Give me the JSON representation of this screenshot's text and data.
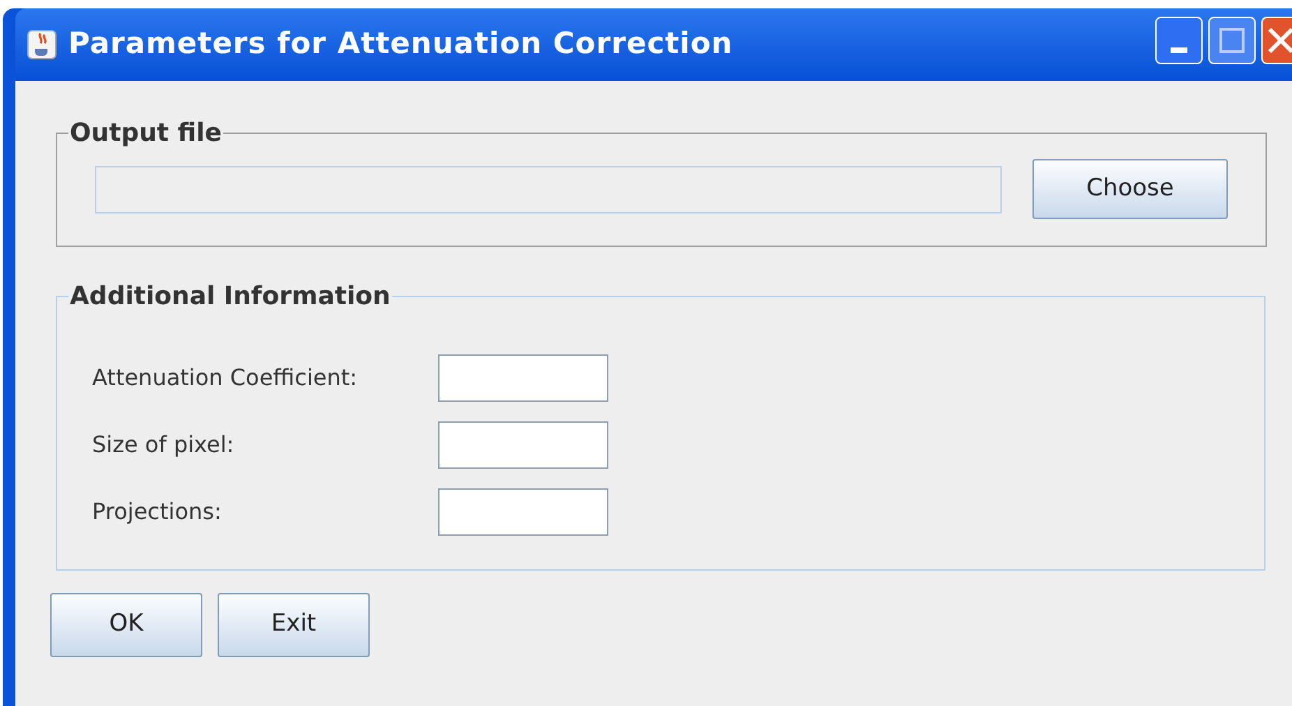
{
  "window": {
    "title": "Parameters for Attenuation Correction"
  },
  "output_file": {
    "legend": "Output file",
    "choose_button": "Choose"
  },
  "additional_information": {
    "legend": "Additional Information",
    "fields": [
      {
        "label": "Attenuation Coefficient:"
      },
      {
        "label": "Size of pixel:"
      },
      {
        "label": "Projections:"
      }
    ]
  },
  "buttons": [
    "OK",
    "Exit"
  ]
}
